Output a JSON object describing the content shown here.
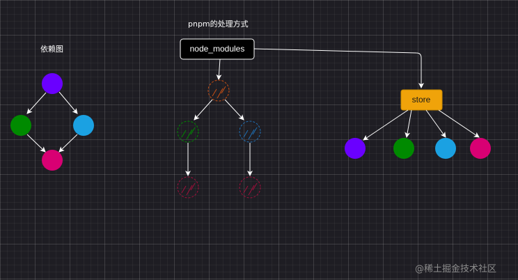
{
  "left_title": "依赖图",
  "middle_title": "pnpm的处理方式",
  "node_modules_label": "node_modules",
  "store_label": "store",
  "watermark": "@稀土掘金技术社区",
  "colors": {
    "purple": "#6a00ff",
    "green": "#008a00",
    "blue": "#1ba1e2",
    "pink": "#d80073",
    "orange": "#f0a30a",
    "hatched_orange": "#c85014",
    "hatched_green": "#008a00",
    "hatched_blue": "#1e6fb4",
    "hatched_pink": "#a0103c"
  }
}
